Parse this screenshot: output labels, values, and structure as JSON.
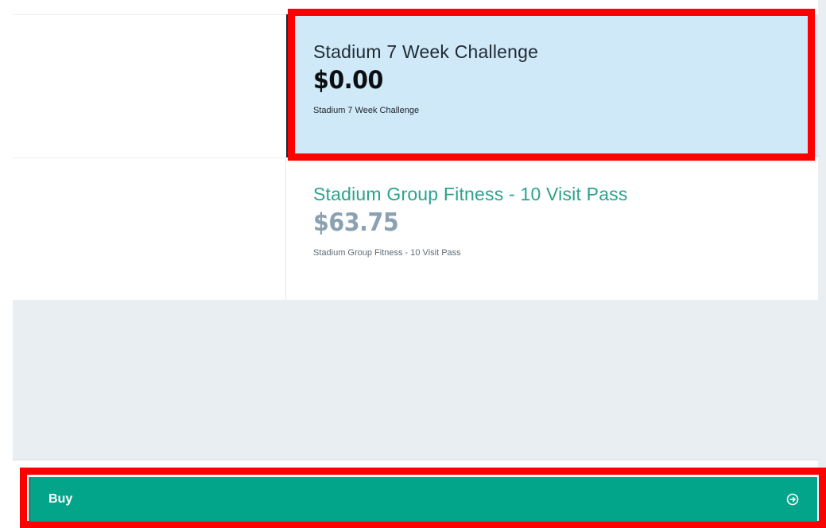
{
  "plans": [
    {
      "name": "Stadium 7 Week Challenge",
      "price": "$0.00",
      "description": "Stadium 7 Week Challenge",
      "selected": true
    },
    {
      "name": "Stadium Group Fitness - 10 Visit Pass",
      "price": "$63.75",
      "description": "Stadium Group Fitness - 10 Visit Pass",
      "selected": false
    }
  ],
  "buy_button": {
    "label": "Buy",
    "icon": "arrow-right-circle-icon"
  },
  "colors": {
    "selected_bg": "#cfe9f8",
    "accent_green": "#03a58a",
    "highlight_red": "#ff0000",
    "muted_price": "#8aa1b1",
    "plan_name_green": "#2ba38d"
  }
}
